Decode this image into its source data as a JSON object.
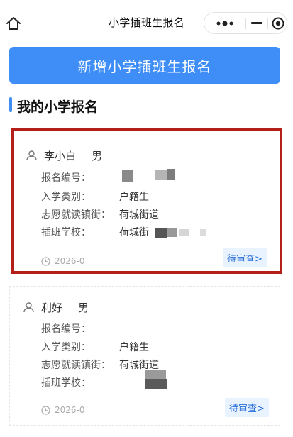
{
  "nav": {
    "title": "小学插班生报名",
    "home_icon": "home-icon",
    "more_icon": "more-dots-icon",
    "minimize_icon": "minimize-icon",
    "close_icon": "close-target-icon"
  },
  "main": {
    "add_button_label": "新增小学插班生报名",
    "section_title": "我的小学报名",
    "accent_color": "#3f8ef7"
  },
  "labels": {
    "reg_no": "报名编号：",
    "category": "入学类别：",
    "street": "志愿就读镇街：",
    "school": "插班学校："
  },
  "applications": [
    {
      "name": "李小白",
      "gender": "男",
      "category": "户籍生",
      "street": "荷城街道",
      "school": "荷城街",
      "time": "2026-0",
      "status": "待审查>"
    },
    {
      "name": "利好",
      "gender": "男",
      "category": "户籍生",
      "street": "荷城街道",
      "school": "",
      "time": "2026-0",
      "status": "待审查>"
    }
  ]
}
